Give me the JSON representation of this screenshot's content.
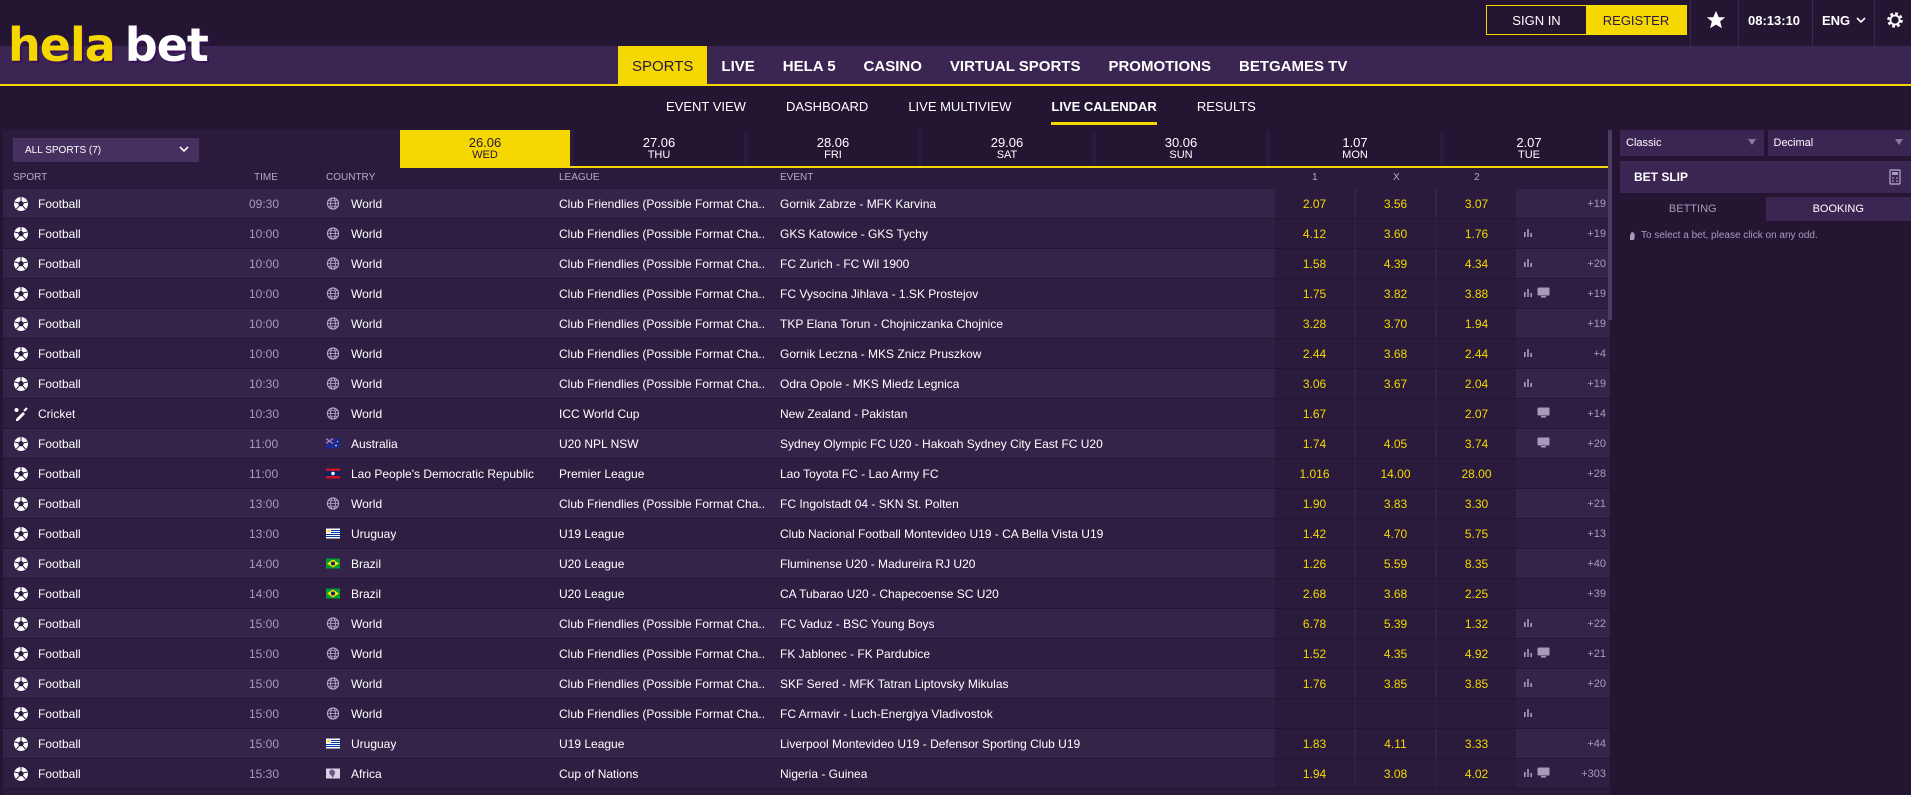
{
  "brand": {
    "logo_left": "hela",
    "logo_right": "bet",
    "accent": "#f5d800",
    "bg": "#241633"
  },
  "header": {
    "sign_in": "SIGN IN",
    "register": "REGISTER",
    "time": "08:13:10",
    "lang": "ENG"
  },
  "nav": [
    {
      "label": "SPORTS",
      "active": true
    },
    {
      "label": "LIVE"
    },
    {
      "label": "HELA 5"
    },
    {
      "label": "CASINO"
    },
    {
      "label": "VIRTUAL SPORTS"
    },
    {
      "label": "PROMOTIONS"
    },
    {
      "label": "BETGAMES TV"
    }
  ],
  "subnav": [
    {
      "label": "EVENT VIEW"
    },
    {
      "label": "DASHBOARD"
    },
    {
      "label": "LIVE MULTIVIEW"
    },
    {
      "label": "LIVE CALENDAR",
      "active": true
    },
    {
      "label": "RESULTS"
    }
  ],
  "sport_select": "ALL SPORTS (7)",
  "dates": [
    {
      "d": "26.06",
      "n": "WED",
      "active": true
    },
    {
      "d": "27.06",
      "n": "THU"
    },
    {
      "d": "28.06",
      "n": "FRI"
    },
    {
      "d": "29.06",
      "n": "SAT"
    },
    {
      "d": "30.06",
      "n": "SUN"
    },
    {
      "d": "1.07",
      "n": "MON"
    },
    {
      "d": "2.07",
      "n": "TUE"
    }
  ],
  "columns": {
    "sport": "SPORT",
    "time": "TIME",
    "country": "COUNTRY",
    "league": "LEAGUE",
    "event": "EVENT",
    "o1": "1",
    "ox": "X",
    "o2": "2"
  },
  "rows": [
    {
      "sport": "Football",
      "time": "09:30",
      "country": "World",
      "flag": "world",
      "league": "Club Friendlies (Possible Format Cha...",
      "event": "Gornik Zabrze - MFK Karvina",
      "o1": "2.07",
      "ox": "3.56",
      "o2": "3.07",
      "stats": false,
      "tv": false,
      "more": "+19"
    },
    {
      "sport": "Football",
      "time": "10:00",
      "country": "World",
      "flag": "world",
      "league": "Club Friendlies (Possible Format Cha...",
      "event": "GKS Katowice - GKS Tychy",
      "o1": "4.12",
      "ox": "3.60",
      "o2": "1.76",
      "stats": true,
      "tv": false,
      "more": "+19"
    },
    {
      "sport": "Football",
      "time": "10:00",
      "country": "World",
      "flag": "world",
      "league": "Club Friendlies (Possible Format Cha...",
      "event": "FC Zurich - FC Wil 1900",
      "o1": "1.58",
      "ox": "4.39",
      "o2": "4.34",
      "stats": true,
      "tv": false,
      "more": "+20"
    },
    {
      "sport": "Football",
      "time": "10:00",
      "country": "World",
      "flag": "world",
      "league": "Club Friendlies (Possible Format Cha...",
      "event": "FC Vysocina Jihlava - 1.SK Prostejov",
      "o1": "1.75",
      "ox": "3.82",
      "o2": "3.88",
      "stats": true,
      "tv": true,
      "more": "+19"
    },
    {
      "sport": "Football",
      "time": "10:00",
      "country": "World",
      "flag": "world",
      "league": "Club Friendlies (Possible Format Cha...",
      "event": "TKP Elana Torun - Chojniczanka Chojnice",
      "o1": "3.28",
      "ox": "3.70",
      "o2": "1.94",
      "stats": false,
      "tv": false,
      "more": "+19"
    },
    {
      "sport": "Football",
      "time": "10:00",
      "country": "World",
      "flag": "world",
      "league": "Club Friendlies (Possible Format Cha...",
      "event": "Gornik Leczna - MKS Znicz Pruszkow",
      "o1": "2.44",
      "ox": "3.68",
      "o2": "2.44",
      "stats": true,
      "tv": false,
      "more": "+4"
    },
    {
      "sport": "Football",
      "time": "10:30",
      "country": "World",
      "flag": "world",
      "league": "Club Friendlies (Possible Format Cha...",
      "event": "Odra Opole - MKS Miedz Legnica",
      "o1": "3.06",
      "ox": "3.67",
      "o2": "2.04",
      "stats": true,
      "tv": false,
      "more": "+19"
    },
    {
      "sport": "Cricket",
      "time": "10:30",
      "country": "World",
      "flag": "world",
      "league": "ICC World Cup",
      "event": "New Zealand - Pakistan",
      "o1": "1.67",
      "ox": "",
      "o2": "2.07",
      "stats": false,
      "tv": true,
      "more": "+14"
    },
    {
      "sport": "Football",
      "time": "11:00",
      "country": "Australia",
      "flag": "au",
      "league": "U20 NPL NSW",
      "event": "Sydney Olympic FC U20 - Hakoah Sydney City East FC U20",
      "o1": "1.74",
      "ox": "4.05",
      "o2": "3.74",
      "stats": false,
      "tv": true,
      "more": "+20"
    },
    {
      "sport": "Football",
      "time": "11:00",
      "country": "Lao People's Democratic Republic",
      "flag": "la",
      "league": "Premier League",
      "event": "Lao Toyota FC - Lao Army FC",
      "o1": "1.016",
      "ox": "14.00",
      "o2": "28.00",
      "stats": false,
      "tv": false,
      "more": "+28"
    },
    {
      "sport": "Football",
      "time": "13:00",
      "country": "World",
      "flag": "world",
      "league": "Club Friendlies (Possible Format Cha...",
      "event": "FC Ingolstadt 04 - SKN St. Polten",
      "o1": "1.90",
      "ox": "3.83",
      "o2": "3.30",
      "stats": false,
      "tv": false,
      "more": "+21"
    },
    {
      "sport": "Football",
      "time": "13:00",
      "country": "Uruguay",
      "flag": "uy",
      "league": "U19 League",
      "event": "Club Nacional Football Montevideo U19 - CA Bella Vista U19",
      "o1": "1.42",
      "ox": "4.70",
      "o2": "5.75",
      "stats": false,
      "tv": false,
      "more": "+13"
    },
    {
      "sport": "Football",
      "time": "14:00",
      "country": "Brazil",
      "flag": "br",
      "league": "U20 League",
      "event": "Fluminense U20 - Madureira RJ U20",
      "o1": "1.26",
      "ox": "5.59",
      "o2": "8.35",
      "stats": false,
      "tv": false,
      "more": "+40"
    },
    {
      "sport": "Football",
      "time": "14:00",
      "country": "Brazil",
      "flag": "br",
      "league": "U20 League",
      "event": "CA Tubarao U20 - Chapecoense SC U20",
      "o1": "2.68",
      "ox": "3.68",
      "o2": "2.25",
      "stats": false,
      "tv": false,
      "more": "+39"
    },
    {
      "sport": "Football",
      "time": "15:00",
      "country": "World",
      "flag": "world",
      "league": "Club Friendlies (Possible Format Cha...",
      "event": "FC Vaduz - BSC Young Boys",
      "o1": "6.78",
      "ox": "5.39",
      "o2": "1.32",
      "stats": true,
      "tv": false,
      "more": "+22"
    },
    {
      "sport": "Football",
      "time": "15:00",
      "country": "World",
      "flag": "world",
      "league": "Club Friendlies (Possible Format Cha...",
      "event": "FK Jablonec - FK Pardubice",
      "o1": "1.52",
      "ox": "4.35",
      "o2": "4.92",
      "stats": true,
      "tv": true,
      "more": "+21"
    },
    {
      "sport": "Football",
      "time": "15:00",
      "country": "World",
      "flag": "world",
      "league": "Club Friendlies (Possible Format Cha...",
      "event": "SKF Sered - MFK Tatran Liptovsky Mikulas",
      "o1": "1.76",
      "ox": "3.85",
      "o2": "3.85",
      "stats": true,
      "tv": false,
      "more": "+20"
    },
    {
      "sport": "Football",
      "time": "15:00",
      "country": "World",
      "flag": "world",
      "league": "Club Friendlies (Possible Format Cha...",
      "event": "FC Armavir - Luch-Energiya Vladivostok",
      "o1": "",
      "ox": "",
      "o2": "",
      "stats": true,
      "tv": false,
      "more": ""
    },
    {
      "sport": "Football",
      "time": "15:00",
      "country": "Uruguay",
      "flag": "uy",
      "league": "U19 League",
      "event": "Liverpool Montevideo U19 - Defensor Sporting Club U19",
      "o1": "1.83",
      "ox": "4.11",
      "o2": "3.33",
      "stats": false,
      "tv": false,
      "more": "+44"
    },
    {
      "sport": "Football",
      "time": "15:30",
      "country": "Africa",
      "flag": "af",
      "league": "Cup of Nations",
      "event": "Nigeria - Guinea",
      "o1": "1.94",
      "ox": "3.08",
      "o2": "4.02",
      "stats": true,
      "tv": true,
      "more": "+303"
    }
  ],
  "betslip": {
    "format1": "Classic",
    "format2": "Decimal",
    "title": "BET SLIP",
    "tab_betting": "BETTING",
    "tab_booking": "BOOKING",
    "hint": "To select a bet, please click on any odd."
  }
}
